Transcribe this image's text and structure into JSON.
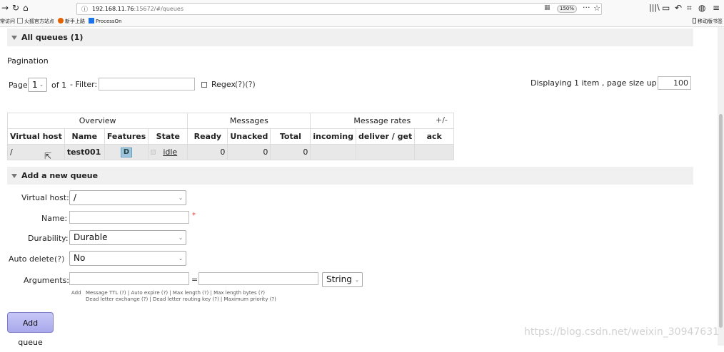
{
  "browser": {
    "url_host": "192.168.11.76",
    "url_path": ":15672/#/queues",
    "zoom": "150%",
    "bookmarks": [
      "常访问",
      "火狐官方站点",
      "新手上路",
      "ProcessOn"
    ],
    "mobile_bookmarks": "移动版书签"
  },
  "all_queues": {
    "title": "All queues (1)"
  },
  "pagination": {
    "heading": "Pagination",
    "page_label": "Page",
    "page_value": "1",
    "of_label": "of 1",
    "filter_label": "- Filter:",
    "filter_value": "",
    "regex_label": "Regex",
    "regex_help": "(?)(?)",
    "displaying": "Displaying 1 item , page size up to:",
    "page_size": "100"
  },
  "table": {
    "groups": [
      "Overview",
      "Messages",
      "Message rates"
    ],
    "toggle": "+/-",
    "columns": [
      "Virtual host",
      "Name",
      "Features",
      "State",
      "Ready",
      "Unacked",
      "Total",
      "incoming",
      "deliver / get",
      "ack"
    ],
    "rows": [
      {
        "vhost": "/",
        "name": "test001",
        "feature": "D",
        "state": "idle",
        "ready": "0",
        "unacked": "0",
        "total": "0",
        "incoming": "",
        "deliver_get": "",
        "ack": ""
      }
    ]
  },
  "add_queue": {
    "title": "Add a new queue",
    "vhost_label": "Virtual host:",
    "vhost_value": "/",
    "name_label": "Name:",
    "name_value": "",
    "required_mark": "*",
    "durability_label": "Durability:",
    "durability_value": "Durable",
    "autodelete_label": "Auto delete:",
    "autodelete_help": "(?)",
    "autodelete_value": "No",
    "arguments_label": "Arguments:",
    "equals": "=",
    "arg_type": "String",
    "add_label": "Add",
    "hints_line1": "Message TTL (?) | Auto expire (?) | Max length (?) | Max length bytes (?)",
    "hints_line2": "Dead letter exchange (?) | Dead letter routing key (?) | Maximum priority (?)",
    "button": "Add queue"
  },
  "watermark": "https://blog.csdn.net/weixin_30947631"
}
